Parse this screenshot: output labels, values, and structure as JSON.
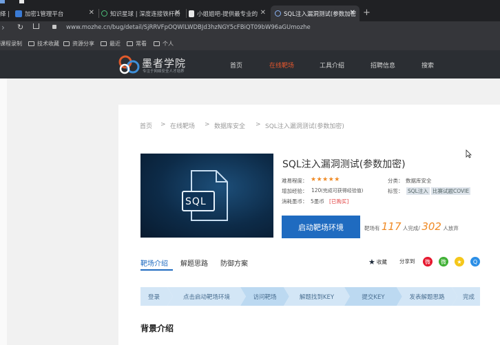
{
  "browser": {
    "tabs": [
      {
        "label": "绎 | ",
        "truncated": true
      },
      {
        "label": "加密1管理平台"
      },
      {
        "label": "知识星球 | 深度连接铁杆粉"
      },
      {
        "label": "小姐姐吧-提供最专业的"
      },
      {
        "label": "SQL注入漏洞测试(参数加密",
        "active": true
      }
    ],
    "url": "www.mozhe.cn/bug/detail/SjRRVFpOQWlLWDBJd3hzNGY5cFBiQT09bW96aGUmozhe",
    "bookmarks": [
      "课程录制",
      "技术收藏",
      "资源分享",
      "最近",
      "常看",
      "个人"
    ]
  },
  "site": {
    "logo": "墨者学院",
    "logo_sub": "专注于网络安全人才培养",
    "nav": [
      "首页",
      "在线靶场",
      "工具介绍",
      "招聘信息",
      "搜索"
    ],
    "nav_active": 1
  },
  "breadcrumb": [
    "首页",
    "在线靶场",
    "数据库安全",
    "SQL注入漏洞测试(参数加密)"
  ],
  "detail": {
    "image_text": "SQL",
    "title": "SQL注入漏洞测试(参数加密)",
    "difficulty_label": "难易程度：",
    "difficulty_stars": "★★★★★",
    "category_label": "分类：",
    "category_value": "数据库安全",
    "exp_label": "增加经验：",
    "exp_value": "120",
    "exp_note": "(完成可获得经验值)",
    "tags_label": "标签：",
    "tags": [
      "SQL注入",
      "比赛试题COVIE"
    ],
    "coin_label": "消耗墨币：",
    "coin_value": "5墨币",
    "purchased": "[已购买]",
    "start_button": "启动靶场环境",
    "stat_prefix": "靶场有",
    "completed": "117",
    "completed_suffix": "人完成/",
    "abandoned": "302",
    "abandoned_suffix": "人放弃"
  },
  "content_tabs": [
    "靶场介绍",
    "解题思路",
    "防御方案"
  ],
  "actions": {
    "favorite": "收藏",
    "share": "分享到"
  },
  "steps": [
    "登录",
    "点击启动靶场环境",
    "访问靶场",
    "解题找到KEY",
    "提交KEY",
    "发表解题思路",
    "完成"
  ],
  "section_title": "背景介绍",
  "colors": {
    "accent": "#1f6bc0",
    "nav_active": "#e4572e",
    "orange": "#f08a24"
  }
}
